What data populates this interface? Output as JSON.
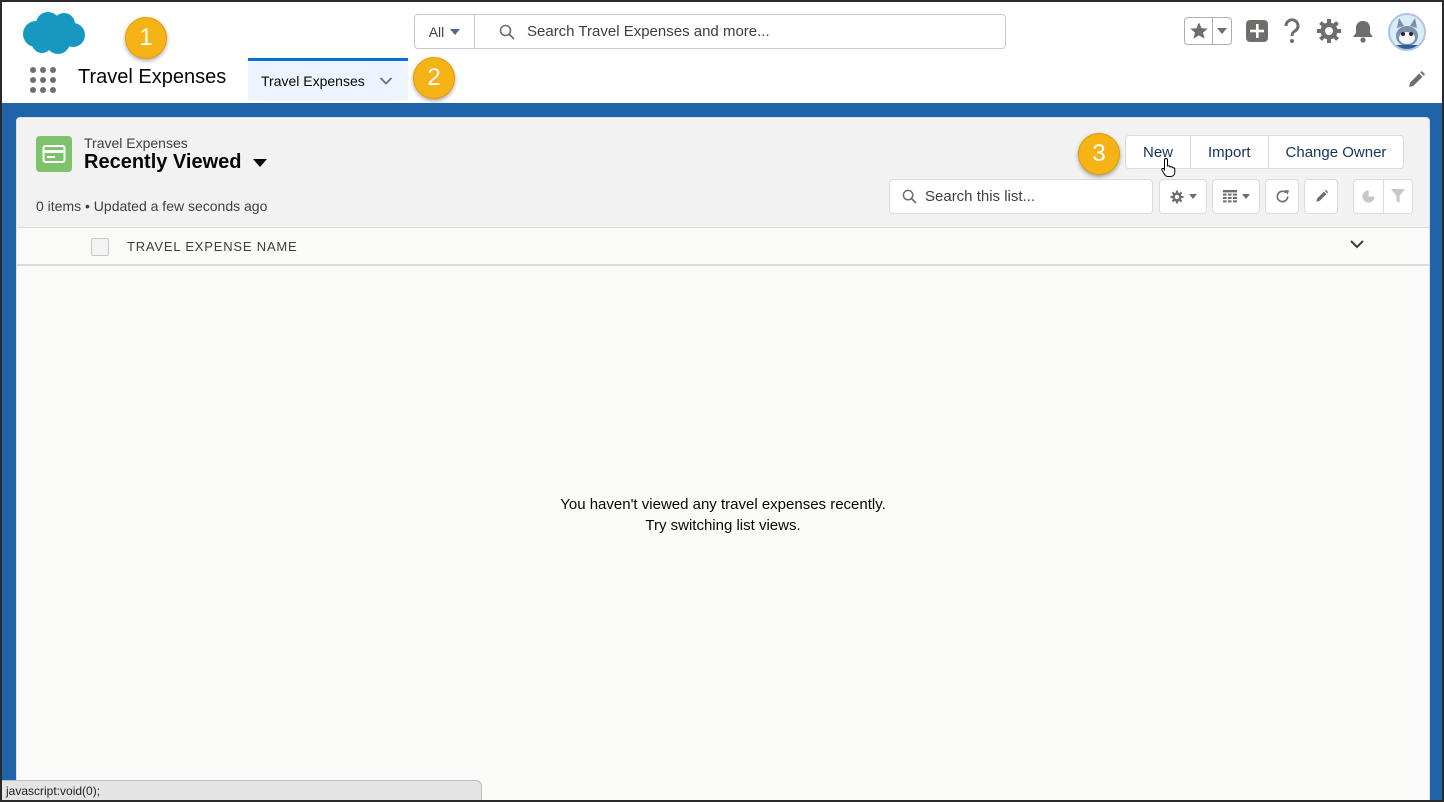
{
  "header": {
    "search_scope": "All",
    "search_placeholder": "Search Travel Expenses and more..."
  },
  "nav": {
    "app_name": "Travel Expenses",
    "tab_label": "Travel Expenses"
  },
  "callouts": [
    "1",
    "2",
    "3"
  ],
  "list_view": {
    "object_label": "Travel Expenses",
    "view_name": "Recently Viewed",
    "meta": "0 items • Updated a few seconds ago",
    "buttons": {
      "new": "New",
      "import": "Import",
      "change_owner": "Change Owner"
    },
    "search_placeholder": "Search this list...",
    "column_header": "TRAVEL EXPENSE NAME",
    "empty_line1": "You haven't viewed any travel expenses recently.",
    "empty_line2": "Try switching list views."
  },
  "status_bar": "javascript:void(0);",
  "colors": {
    "brand_blue": "#1f64a8",
    "object_icon_green": "#7ec26b",
    "callout_orange": "#f5b316",
    "active_tab_border": "#0070d2"
  },
  "icons": [
    "salesforce-cloud-logo",
    "search-icon",
    "favorites-star-icon",
    "global-actions-plus-icon",
    "help-icon",
    "setup-gear-icon",
    "notifications-bell-icon",
    "avatar",
    "app-launcher-icon",
    "chevron-down-icon",
    "pencil-edit-icon",
    "settings-gear-icon",
    "table-display-icon",
    "refresh-icon",
    "chart-icon",
    "filter-icon"
  ]
}
